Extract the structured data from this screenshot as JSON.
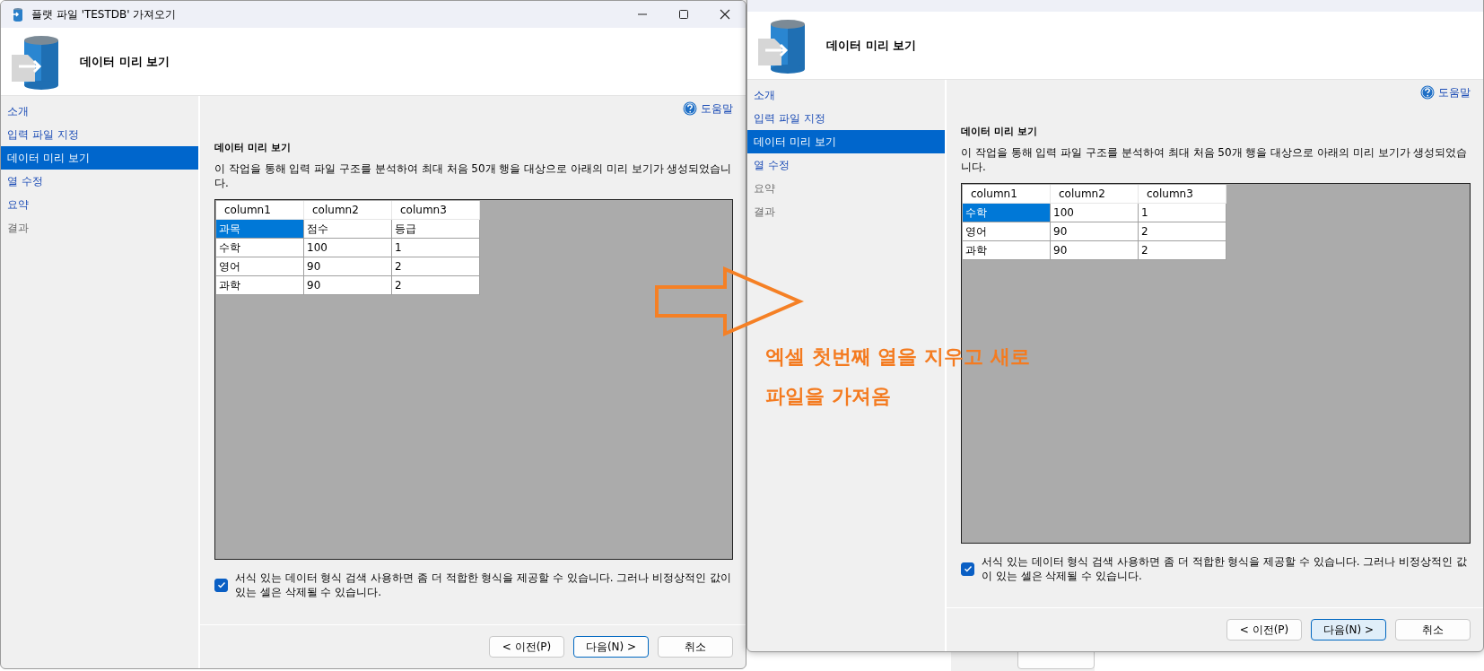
{
  "windows": [
    {
      "title": "플랫 파일 'TESTDB' 가져오기",
      "header_title": "데이터 미리 보기",
      "steps": [
        {
          "label": "소개",
          "selected": false,
          "disabled": false
        },
        {
          "label": "입력 파일 지정",
          "selected": false,
          "disabled": false
        },
        {
          "label": "데이터 미리 보기",
          "selected": true,
          "disabled": false
        },
        {
          "label": "열 수정",
          "selected": false,
          "disabled": false
        },
        {
          "label": "요약",
          "selected": false,
          "disabled": false
        },
        {
          "label": "결과",
          "selected": false,
          "disabled": true
        }
      ],
      "help_link": "도움말",
      "section_title": "데이터 미리 보기",
      "description": "이 작업을 통해 입력 파일 구조를 분석하여 최대 처음 50개 행을 대상으로 아래의 미리 보기가 생성되었습니다.",
      "table": {
        "columns": [
          "column1",
          "column2",
          "column3"
        ],
        "rows": [
          {
            "cells": [
              {
                "text": "과목",
                "selected": true
              },
              {
                "text": "점수",
                "selected": false
              },
              {
                "text": "등급",
                "selected": false
              }
            ]
          },
          {
            "cells": [
              {
                "text": "수학",
                "selected": false
              },
              {
                "text": "100",
                "selected": false
              },
              {
                "text": "1",
                "selected": false
              }
            ]
          },
          {
            "cells": [
              {
                "text": "영어",
                "selected": false
              },
              {
                "text": "90",
                "selected": false
              },
              {
                "text": "2",
                "selected": false
              }
            ]
          },
          {
            "cells": [
              {
                "text": "과학",
                "selected": false
              },
              {
                "text": "90",
                "selected": false
              },
              {
                "text": "2",
                "selected": false
              }
            ]
          }
        ]
      },
      "checkbox": {
        "label": "서식 있는 데이터 형식 검색 사용하면 좀 더 적합한 형식을 제공할 수 있습니다. 그러나 비정상적인 값이 있는 셀은 삭제될 수 있습니다.",
        "checked": true
      },
      "buttons": [
        {
          "label": "< 이전(P)",
          "default": false,
          "hovered": false
        },
        {
          "label": "다음(N) >",
          "default": true,
          "hovered": false
        },
        {
          "label": "취소",
          "default": false,
          "hovered": false
        }
      ]
    },
    {
      "header_title": "데이터 미리 보기",
      "steps": [
        {
          "label": "소개",
          "selected": false,
          "disabled": false
        },
        {
          "label": "입력 파일 지정",
          "selected": false,
          "disabled": false
        },
        {
          "label": "데이터 미리 보기",
          "selected": true,
          "disabled": false
        },
        {
          "label": "열 수정",
          "selected": false,
          "disabled": false
        },
        {
          "label": "요약",
          "selected": false,
          "disabled": true
        },
        {
          "label": "결과",
          "selected": false,
          "disabled": true
        }
      ],
      "help_link": "도움말",
      "section_title": "데이터 미리 보기",
      "description": "이 작업을 통해 입력 파일 구조를 분석하여 최대 처음 50개 행을 대상으로 아래의 미리 보기가 생성되었습니다.",
      "table": {
        "columns": [
          "column1",
          "column2",
          "column3"
        ],
        "rows": [
          {
            "cells": [
              {
                "text": "수학",
                "selected": true
              },
              {
                "text": "100",
                "selected": false
              },
              {
                "text": "1",
                "selected": false
              }
            ]
          },
          {
            "cells": [
              {
                "text": "영어",
                "selected": false
              },
              {
                "text": "90",
                "selected": false
              },
              {
                "text": "2",
                "selected": false
              }
            ]
          },
          {
            "cells": [
              {
                "text": "과학",
                "selected": false
              },
              {
                "text": "90",
                "selected": false
              },
              {
                "text": "2",
                "selected": false
              }
            ]
          }
        ]
      },
      "checkbox": {
        "label": "서식 있는 데이터 형식 검색 사용하면 좀 더 적합한 형식을 제공할 수 있습니다. 그러나 비정상적인 값이 있는 셀은 삭제될 수 있습니다.",
        "checked": true
      },
      "buttons": [
        {
          "label": "< 이전(P)",
          "default": false,
          "hovered": false
        },
        {
          "label": "다음(N) >",
          "default": true,
          "hovered": true
        },
        {
          "label": "취소",
          "default": false,
          "hovered": false
        }
      ]
    }
  ],
  "annotation": {
    "lines": [
      "엑셀 첫번째 열을 지우고 새로",
      "파일을 가져옴"
    ]
  }
}
